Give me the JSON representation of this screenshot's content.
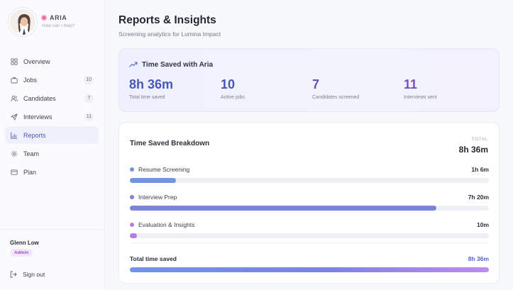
{
  "assistant": {
    "name": "ARIA",
    "tagline": "How can I help?"
  },
  "nav": [
    {
      "key": "overview",
      "label": "Overview",
      "count": null,
      "icon": "grid-icon",
      "active": false
    },
    {
      "key": "jobs",
      "label": "Jobs",
      "count": "10",
      "icon": "briefcase-icon",
      "active": false
    },
    {
      "key": "candidates",
      "label": "Candidates",
      "count": "7",
      "icon": "users-icon",
      "active": false
    },
    {
      "key": "interviews",
      "label": "Interviews",
      "count": "11",
      "icon": "send-icon",
      "active": false
    },
    {
      "key": "reports",
      "label": "Reports",
      "count": null,
      "icon": "bar-chart-icon",
      "active": true
    },
    {
      "key": "team",
      "label": "Team",
      "count": null,
      "icon": "gear-icon",
      "active": false
    },
    {
      "key": "plan",
      "label": "Plan",
      "count": null,
      "icon": "card-icon",
      "active": false
    }
  ],
  "user": {
    "name": "Glenn Low",
    "role": "Admin",
    "signout_label": "Sign out"
  },
  "page": {
    "title": "Reports & Insights",
    "subtitle": "Screening analytics for Lumina Impact"
  },
  "hero": {
    "title": "Time Saved with Aria",
    "stats": [
      {
        "value": "8h 36m",
        "label": "Total time saved",
        "color": "#4a56b8"
      },
      {
        "value": "10",
        "label": "Active jobs",
        "color": "#4a56b8"
      },
      {
        "value": "7",
        "label": "Candidates screened",
        "color": "#6b4fb8"
      },
      {
        "value": "11",
        "label": "Interviews sent",
        "color": "#7c4fc0"
      }
    ]
  },
  "breakdown": {
    "title": "Time Saved Breakdown",
    "total_label": "TOTAL",
    "total_value": "8h 36m",
    "items": [
      {
        "label": "Resume Screening",
        "value": "1h 6m",
        "fraction": 0.128,
        "color": "#6f95e3",
        "dot": "#6f95e3"
      },
      {
        "label": "Interview Prep",
        "value": "7h 20m",
        "fraction": 0.853,
        "color": "#7a84db",
        "dot": "#7a84db"
      },
      {
        "label": "Evaluation & Insights",
        "value": "10m",
        "fraction": 0.019,
        "color": "#b37ee4",
        "dot": "#b37ee4"
      }
    ],
    "footer_label": "Total time saved",
    "footer_value": "8h 36m"
  }
}
